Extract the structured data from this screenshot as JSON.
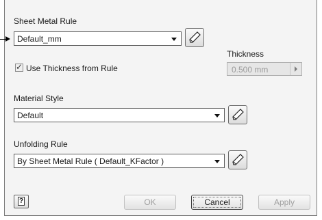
{
  "sheet_metal_rule": {
    "label": "Sheet Metal Rule",
    "value": "Default_mm"
  },
  "thickness": {
    "label": "Thickness",
    "value": "0.500 mm"
  },
  "use_thickness": {
    "label": "Use Thickness from Rule",
    "checked": true
  },
  "material_style": {
    "label": "Material Style",
    "value": "Default"
  },
  "unfolding_rule": {
    "label": "Unfolding Rule",
    "value": "By Sheet Metal Rule ( Default_KFactor )"
  },
  "buttons": {
    "ok": "OK",
    "cancel": "Cancel",
    "apply": "Apply"
  },
  "icons": {
    "edit": "pencil-icon",
    "help": "help-icon",
    "pointer": "arrow-pointer"
  }
}
